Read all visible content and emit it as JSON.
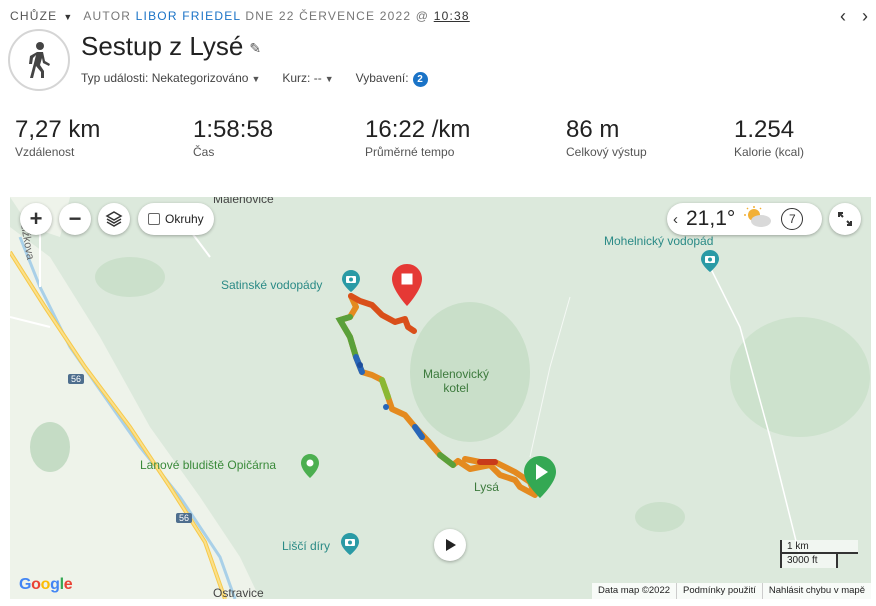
{
  "header": {
    "activity_type": "CHŮZE",
    "author_prefix": "AUTOR",
    "author_name": "LIBOR FRIEDEL",
    "date_text": "DNE 22 ČERVENCE 2022 @",
    "time": "10:38"
  },
  "title": "Sestup z Lysé",
  "meta": {
    "event_type_label": "Typ události:",
    "event_type_value": "Nekategorizováno",
    "course_label": "Kurz:",
    "course_value": "--",
    "gear_label": "Vybavení:",
    "gear_count": "2"
  },
  "stats": [
    {
      "value": "7,27 km",
      "label": "Vzdálenost"
    },
    {
      "value": "1:58:58",
      "label": "Čas"
    },
    {
      "value": "16:22 /km",
      "label": "Průměrné tempo"
    },
    {
      "value": "86 m",
      "label": "Celkový výstup"
    },
    {
      "value": "1.254",
      "label": "Kalorie (kcal)"
    }
  ],
  "map": {
    "okruhy_label": "Okruhy",
    "temperature": "21,1°",
    "wind": "7",
    "labels": {
      "malenovice": "Malenovice",
      "satinske": "Satinské vodopády",
      "mohelnicky": "Mohelnický vodopád",
      "kotel_line1": "Malenovický",
      "kotel_line2": "kotel",
      "bludiste": "Lanové bludiště Opičárna",
      "lisci": "Liščí díry",
      "lysa": "Lysá",
      "ostravice": "Ostravice",
      "zizkova": "Žižkova",
      "road56a": "56",
      "road56b": "56"
    },
    "scale_km": "1 km",
    "scale_ft": "3000 ft",
    "attribution": [
      "Data map ©2022",
      "Podmínky použití",
      "Nahlásit chybu v mapě"
    ],
    "google": "Google"
  },
  "colors": {
    "accent": "#1a73c7",
    "start_marker": "#34a853",
    "end_marker": "#e53935"
  }
}
